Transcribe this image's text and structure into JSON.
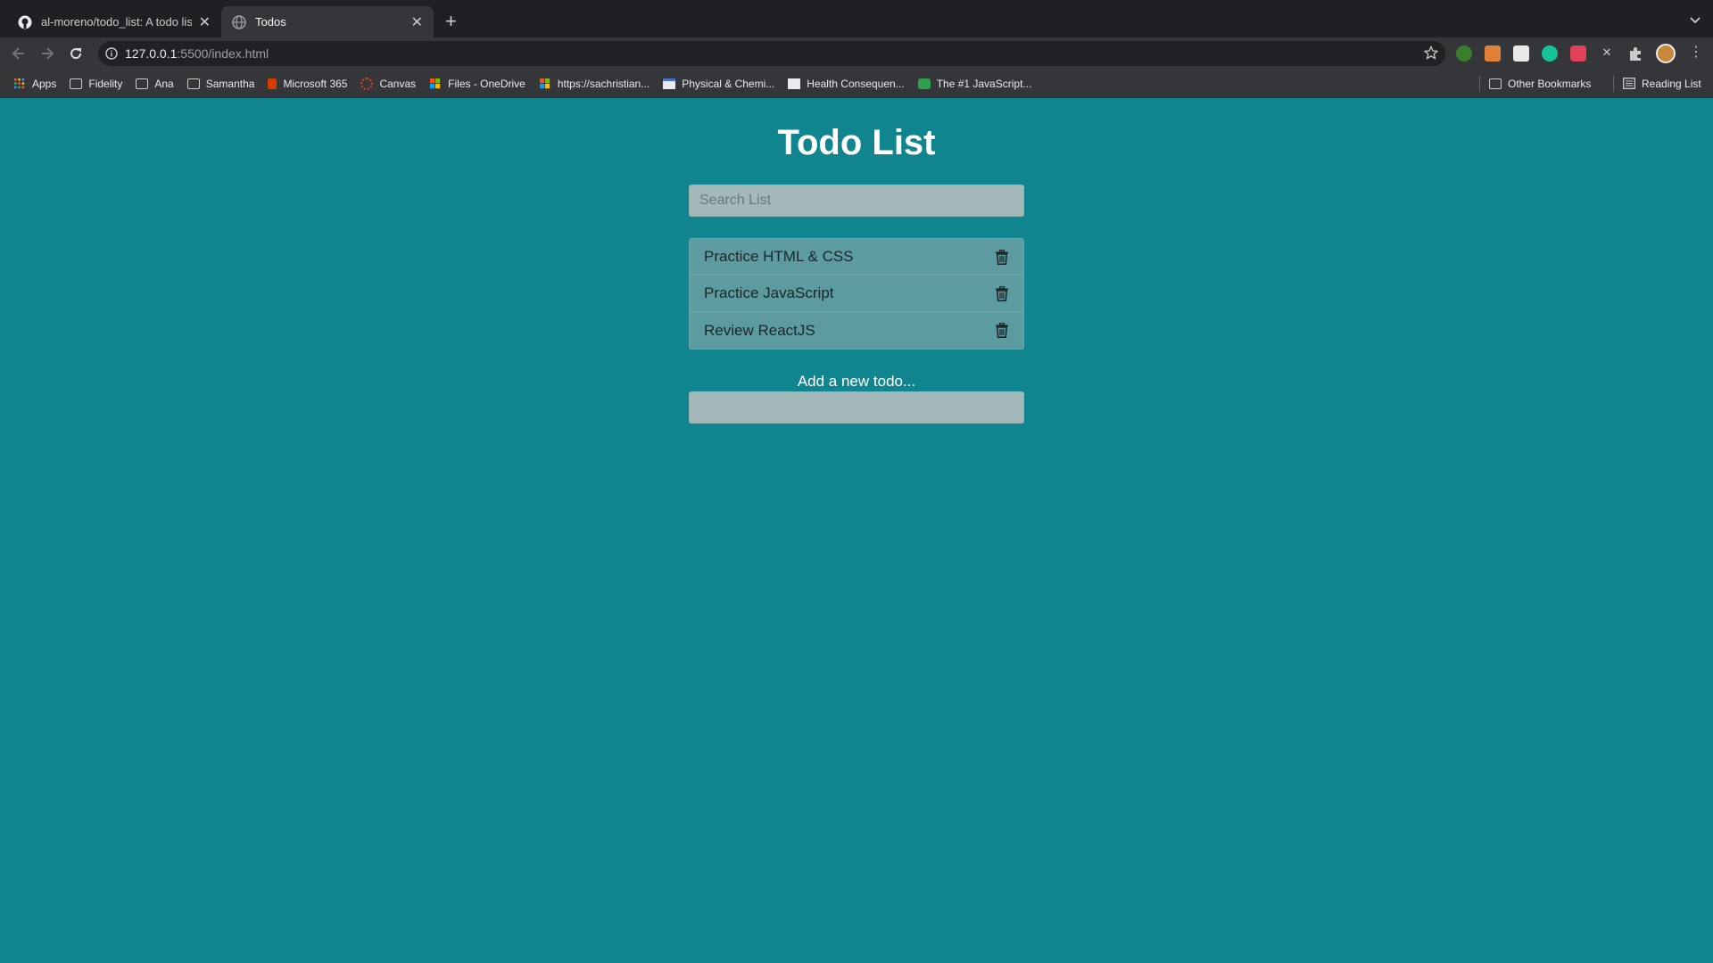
{
  "tabs": [
    {
      "title": "al-moreno/todo_list: A todo list",
      "active": false,
      "icon": "github-icon"
    },
    {
      "title": "Todos",
      "active": true,
      "icon": "globe-icon"
    }
  ],
  "address_bar": {
    "host": "127.0.0.1",
    "path": ":5500/index.html"
  },
  "bookmarks": [
    {
      "label": "Apps",
      "icon": "apps-grid-icon"
    },
    {
      "label": "Fidelity",
      "icon": "folder-icon"
    },
    {
      "label": "Ana",
      "icon": "folder-icon"
    },
    {
      "label": "Samantha",
      "icon": "folder-icon"
    },
    {
      "label": "Microsoft 365",
      "icon": "office-icon"
    },
    {
      "label": "Canvas",
      "icon": "canvas-icon"
    },
    {
      "label": "Files - OneDrive",
      "icon": "microsoft-icon"
    },
    {
      "label": "https://sachristian...",
      "icon": "microsoft-icon"
    },
    {
      "label": "Physical & Chemi...",
      "icon": "page-icon"
    },
    {
      "label": "Health Consequen...",
      "icon": "page-icon"
    },
    {
      "label": "The #1 JavaScript...",
      "icon": "clock-icon"
    }
  ],
  "bookmarks_right": {
    "other": "Other Bookmarks",
    "reading": "Reading List"
  },
  "app": {
    "title": "Todo List",
    "search_placeholder": "Search List",
    "todos": [
      "Practice HTML & CSS",
      "Practice JavaScript",
      "Review ReactJS"
    ],
    "add_label": "Add a new todo...",
    "add_value": ""
  },
  "colors": {
    "page_background": "#11858f",
    "input_background": "#a3b8b9",
    "list_background": "#5c9ca1"
  }
}
